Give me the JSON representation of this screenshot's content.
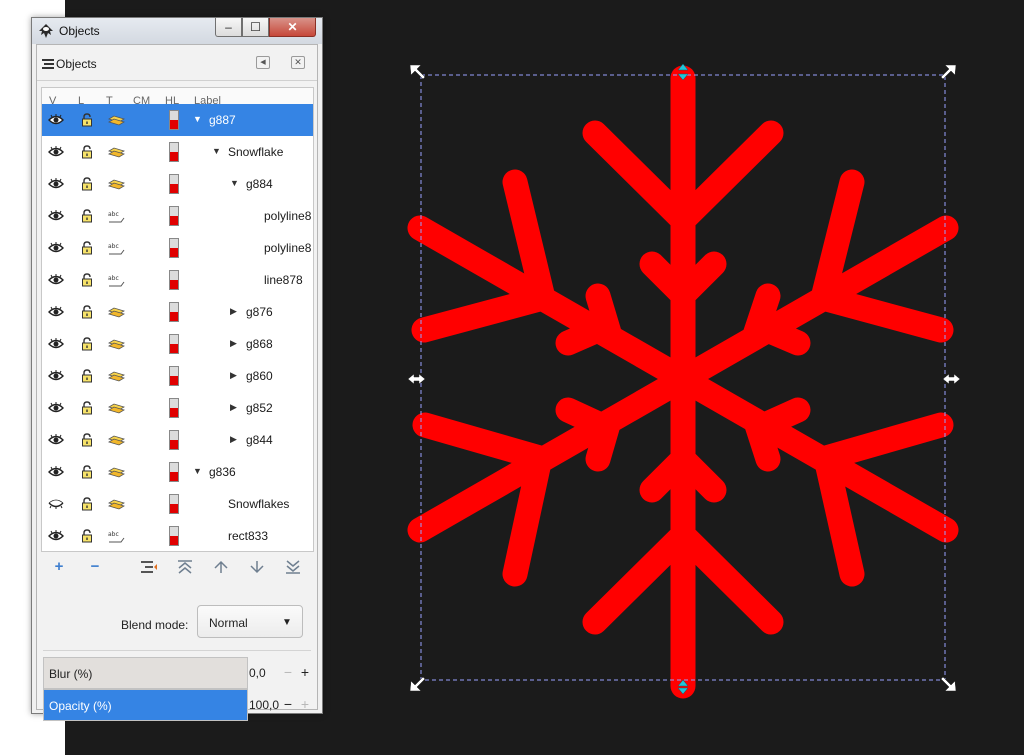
{
  "window": {
    "title": "Objects",
    "minimize_label": "–",
    "maximize_label": "☐",
    "close_label": "✕"
  },
  "panel": {
    "title": "Objects",
    "columns": [
      "V",
      "L",
      "T",
      "CM",
      "HL",
      "Label"
    ],
    "rows": [
      {
        "label": "g887",
        "type": "group",
        "expander": "open",
        "selected": true,
        "visible": true
      },
      {
        "label": "Snowflake",
        "type": "group",
        "expander": "open",
        "selected": false,
        "visible": true
      },
      {
        "label": "g884",
        "type": "group",
        "expander": "open",
        "selected": false,
        "visible": true
      },
      {
        "label": "polyline8",
        "type": "text",
        "expander": "none",
        "selected": false,
        "visible": true
      },
      {
        "label": "polyline8",
        "type": "text",
        "expander": "none",
        "selected": false,
        "visible": true
      },
      {
        "label": "line878",
        "type": "text",
        "expander": "none",
        "selected": false,
        "visible": true
      },
      {
        "label": "g876",
        "type": "group",
        "expander": "closed",
        "selected": false,
        "visible": true
      },
      {
        "label": "g868",
        "type": "group",
        "expander": "closed",
        "selected": false,
        "visible": true
      },
      {
        "label": "g860",
        "type": "group",
        "expander": "closed",
        "selected": false,
        "visible": true
      },
      {
        "label": "g852",
        "type": "group",
        "expander": "closed",
        "selected": false,
        "visible": true
      },
      {
        "label": "g844",
        "type": "group",
        "expander": "closed",
        "selected": false,
        "visible": true
      },
      {
        "label": "g836",
        "type": "group",
        "expander": "open",
        "selected": false,
        "visible": true
      },
      {
        "label": "Snowflakes",
        "type": "group",
        "expander": "none",
        "selected": false,
        "visible": false
      },
      {
        "label": "rect833",
        "type": "text",
        "expander": "none",
        "selected": false,
        "visible": true
      }
    ],
    "toolbar": {
      "add_icon": "plus-icon",
      "remove_icon": "minus-icon",
      "indent_icon": "unindent-icon",
      "top_icon": "move-to-top-icon",
      "up_icon": "move-up-icon",
      "down_icon": "move-down-icon",
      "bottom_icon": "move-to-bottom-icon"
    },
    "blend_mode": {
      "label": "Blend mode:",
      "value": "Normal"
    },
    "blur": {
      "label": "Blur (%)",
      "value": "0,0",
      "fraction": 0
    },
    "opacity": {
      "label": "Opacity (%)",
      "value": "100,0",
      "fraction": 1
    }
  },
  "colors": {
    "canvas": "#1b1b1b",
    "snowflake": "#ff0000",
    "selection": "#3584e4"
  }
}
